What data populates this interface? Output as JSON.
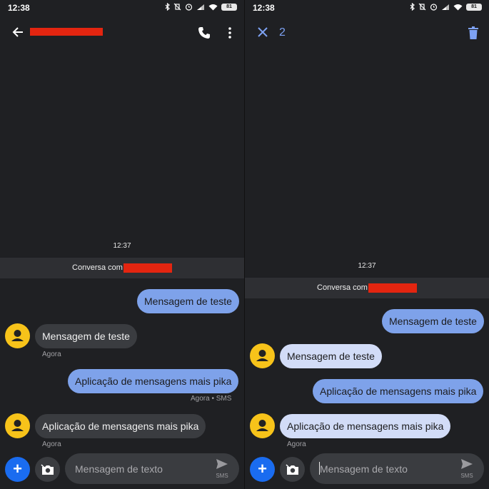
{
  "status_bar": {
    "time": "12:38",
    "battery": "81"
  },
  "conversation": {
    "timestamp": "12:37",
    "banner_prefix": "Conversa com",
    "messages": [
      {
        "text": "Mensagem de teste",
        "direction": "out"
      },
      {
        "text": "Mensagem de teste",
        "direction": "in",
        "meta": "Agora"
      },
      {
        "text": "Aplicação de mensagens mais pika",
        "direction": "out",
        "meta": "Agora • SMS"
      },
      {
        "text": "Aplicação de mensagens mais pika",
        "direction": "in",
        "meta": "Agora"
      }
    ]
  },
  "selection": {
    "count": "2"
  },
  "compose": {
    "placeholder": "Mensagem de texto",
    "send_label": "SMS",
    "add_label": "+"
  },
  "colors": {
    "background": "#1f2023",
    "outgoing": "#7ea2ea",
    "incoming": "#3a3c40",
    "selected": "#d2dcf7",
    "accent": "#1a6cf0",
    "redaction": "#e32510"
  },
  "icons": [
    "back-arrow-icon",
    "phone-icon",
    "more-vert-icon",
    "close-icon",
    "trash-icon",
    "camera-icon",
    "send-icon",
    "person-icon",
    "bluetooth-icon",
    "alarm-icon",
    "signal-icon",
    "wifi-icon",
    "battery-icon"
  ]
}
